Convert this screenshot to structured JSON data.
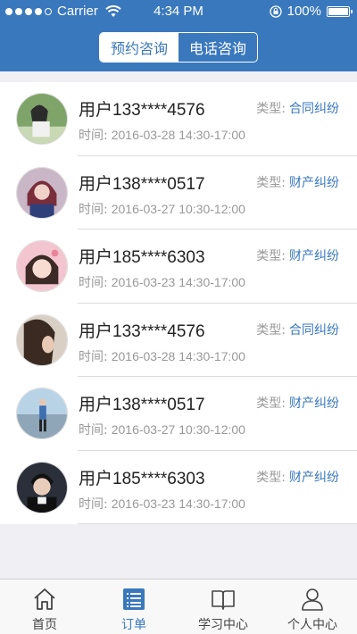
{
  "status_bar": {
    "carrier": "Carrier",
    "time": "4:34 PM",
    "battery": "100%"
  },
  "header": {
    "segments": [
      {
        "label": "预约咨询",
        "active": true
      },
      {
        "label": "电话咨询",
        "active": false
      }
    ]
  },
  "orders": [
    {
      "user": "用户133****4576",
      "type_label": "类型:",
      "type": "合同纠纷",
      "time_label": "时间:",
      "time": "2016-03-28  14:30-17:00"
    },
    {
      "user": "用户138****0517",
      "type_label": "类型:",
      "type": "财产纠纷",
      "time_label": "时间:",
      "time": "2016-03-27  10:30-12:00"
    },
    {
      "user": "用户185****6303",
      "type_label": "类型:",
      "type": "财产纠纷",
      "time_label": "时间:",
      "time": "2016-03-23  14:30-17:00"
    },
    {
      "user": "用户133****4576",
      "type_label": "类型:",
      "type": "合同纠纷",
      "time_label": "时间:",
      "time": "2016-03-28  14:30-17:00"
    },
    {
      "user": "用户138****0517",
      "type_label": "类型:",
      "type": "财产纠纷",
      "time_label": "时间:",
      "time": "2016-03-27  10:30-12:00"
    },
    {
      "user": "用户185****6303",
      "type_label": "类型:",
      "type": "财产纠纷",
      "time_label": "时间:",
      "time": "2016-03-23  14:30-17:00"
    }
  ],
  "tabbar": {
    "items": [
      {
        "label": "首页",
        "icon": "home-icon",
        "active": false
      },
      {
        "label": "订单",
        "icon": "order-list-icon",
        "active": true
      },
      {
        "label": "学习中心",
        "icon": "book-icon",
        "active": false
      },
      {
        "label": "个人中心",
        "icon": "person-icon",
        "active": false
      }
    ]
  },
  "colors": {
    "brand": "#3a78bd",
    "muted_text": "#999999",
    "background": "#efeff4"
  }
}
